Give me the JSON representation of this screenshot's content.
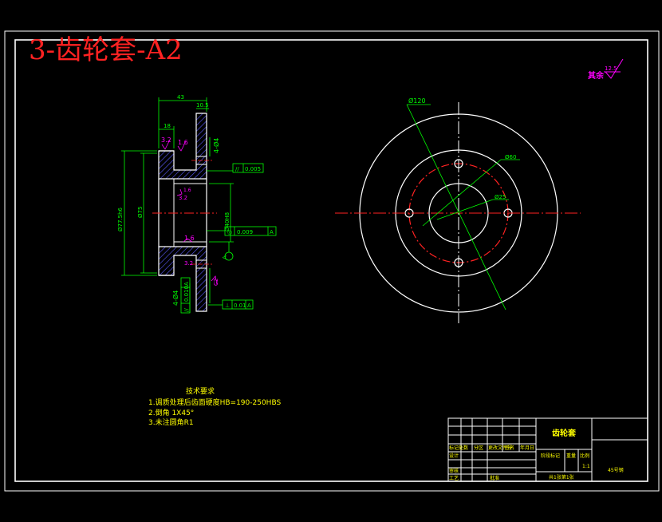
{
  "title": "3-齿轮套-A2",
  "roughness_note": {
    "text": "其余",
    "value": "12.5"
  },
  "colors": {
    "background": "#000000",
    "line": "#ffffff",
    "dimension": "#00ff00",
    "center": "#ff0000",
    "annotation": "#ff00ff",
    "note": "#ffff00",
    "title": "#ff0000"
  },
  "section_view": {
    "dims": {
      "overall_width": "43",
      "flange_width": "10.5",
      "hub_width": "18",
      "od": "Ø77.5h6",
      "d2": "Ø75",
      "bore": "Ø40H8",
      "holes_top": "4-Ø4",
      "holes_bottom": "4-Ø4",
      "chamfer": "C2"
    },
    "roughness": [
      "3.2",
      "1.6",
      "3.2",
      "1.6",
      "1.6",
      "3.2",
      "3.2",
      "1.6"
    ],
    "tolerances": [
      {
        "symbol": "//",
        "value": "0.005",
        "datum": ""
      },
      {
        "symbol": "◎",
        "value": "0.009",
        "datum": "A"
      },
      {
        "symbol": "//",
        "value": "0.010",
        "datum": "A"
      },
      {
        "symbol": "⊥",
        "value": "0.01",
        "datum": "A"
      }
    ],
    "datum": "A"
  },
  "front_view": {
    "dims": {
      "d120": "Ø120",
      "d60": "Ø60",
      "d25": "Ø25"
    }
  },
  "tech_requirements": {
    "title": "技术要求",
    "items": [
      "1.调质处理后齿面硬度HB=190-250HBS",
      "2.倒角 1X45°",
      "3.未注圆角R1"
    ]
  },
  "title_block": {
    "part_name": "齿轮套",
    "material": "45号钢",
    "scale": "1:1",
    "header": [
      "标记处数",
      "分区",
      "更改文件号",
      "签名",
      "年月日"
    ],
    "labels": {
      "design": "设计",
      "check": "审核",
      "process": "工艺",
      "approve": "批准",
      "stage_mark": "阶段标记",
      "weight": "重量",
      "ratio": "比例",
      "sheets": "共1张第1张"
    }
  }
}
